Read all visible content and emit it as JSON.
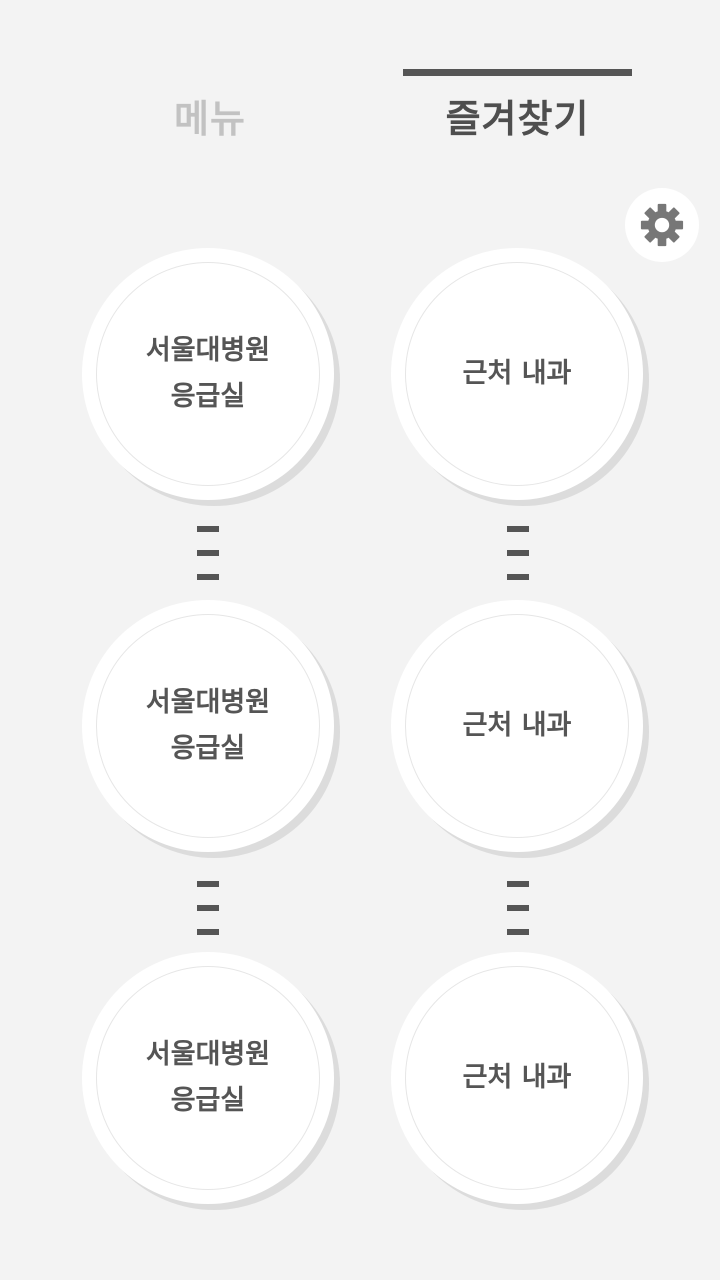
{
  "tabs": {
    "menu_label": "메뉴",
    "favorites_label": "즐겨찾기",
    "active": "favorites"
  },
  "settings": {
    "icon": "gear-icon"
  },
  "favorites": [
    {
      "left": "서울대병원\n응급실",
      "right": "근처 내과"
    },
    {
      "left": "서울대병원\n응급실",
      "right": "근처 내과"
    },
    {
      "left": "서울대병원\n응급실",
      "right": "근처 내과"
    }
  ],
  "colors": {
    "background": "#f3f3f3",
    "active_tab": "#4e4e4e",
    "inactive_tab": "#c2c2c2",
    "text": "#555555",
    "icon": "#777777"
  }
}
